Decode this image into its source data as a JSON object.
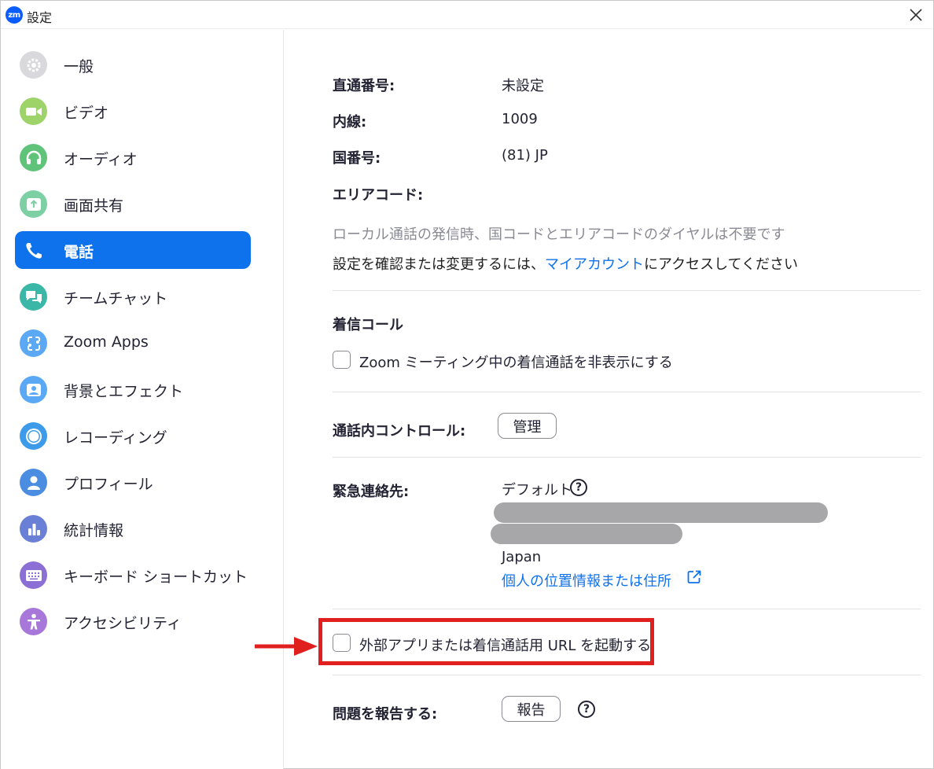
{
  "window": {
    "title": "設定",
    "app_icon_text": "zm"
  },
  "sidebar": {
    "items": [
      {
        "label": "一般",
        "icon": "gear-icon",
        "color": "#d9d9dd",
        "active": false
      },
      {
        "label": "ビデオ",
        "icon": "video-camera-icon",
        "color": "#9ed36a",
        "active": false
      },
      {
        "label": "オーディオ",
        "icon": "headphones-icon",
        "color": "#5fc37a",
        "active": false
      },
      {
        "label": "画面共有",
        "icon": "share-screen-icon",
        "color": "#7dd0a4",
        "active": false
      },
      {
        "label": "電話",
        "icon": "phone-icon",
        "color": "#0e72ed",
        "active": true
      },
      {
        "label": "チームチャット",
        "icon": "chat-icon",
        "color": "#3bb7a8",
        "active": false
      },
      {
        "label": "Zoom Apps",
        "icon": "apps-icon",
        "color": "#5ba8f5",
        "active": false
      },
      {
        "label": "背景とエフェクト",
        "icon": "background-icon",
        "color": "#5ba8f5",
        "active": false
      },
      {
        "label": "レコーディング",
        "icon": "record-icon",
        "color": "#3d9be9",
        "active": false
      },
      {
        "label": "プロフィール",
        "icon": "profile-icon",
        "color": "#4b8de0",
        "active": false
      },
      {
        "label": "統計情報",
        "icon": "statistics-icon",
        "color": "#6a7fd6",
        "active": false
      },
      {
        "label": "キーボード ショートカット",
        "icon": "keyboard-icon",
        "color": "#8b6fd4",
        "active": false
      },
      {
        "label": "アクセシビリティ",
        "icon": "accessibility-icon",
        "color": "#a777d9",
        "active": false
      }
    ]
  },
  "phone": {
    "direct_number_label": "直通番号:",
    "direct_number_value": "未設定",
    "extension_label": "内線:",
    "extension_value": "1009",
    "country_code_label": "国番号:",
    "country_code_value": "(81) JP",
    "area_code_label": "エリアコード:",
    "local_call_note": "ローカル通話の発信時、国コードとエリアコードのダイヤルは不要です",
    "confirm_note_prefix": "設定を確認または変更するには、",
    "confirm_note_link": "マイアカウント",
    "confirm_note_suffix": "にアクセスしてください",
    "incoming_call_title": "着信コール",
    "hide_incoming_label": "Zoom ミーティング中の着信通話を非表示にする",
    "in_call_controls_label": "通話内コントロール:",
    "manage_button": "管理",
    "emergency_label": "緊急連絡先:",
    "emergency_default": "デフォルト",
    "emergency_country": "Japan",
    "personal_location_link": "個人の位置情報または住所",
    "launch_external_label": "外部アプリまたは着信通話用 URL を起動する",
    "report_problem_label": "問題を報告する:",
    "report_button": "報告"
  },
  "colors": {
    "accent": "#0e72ed",
    "annotation": "#e0201f"
  }
}
